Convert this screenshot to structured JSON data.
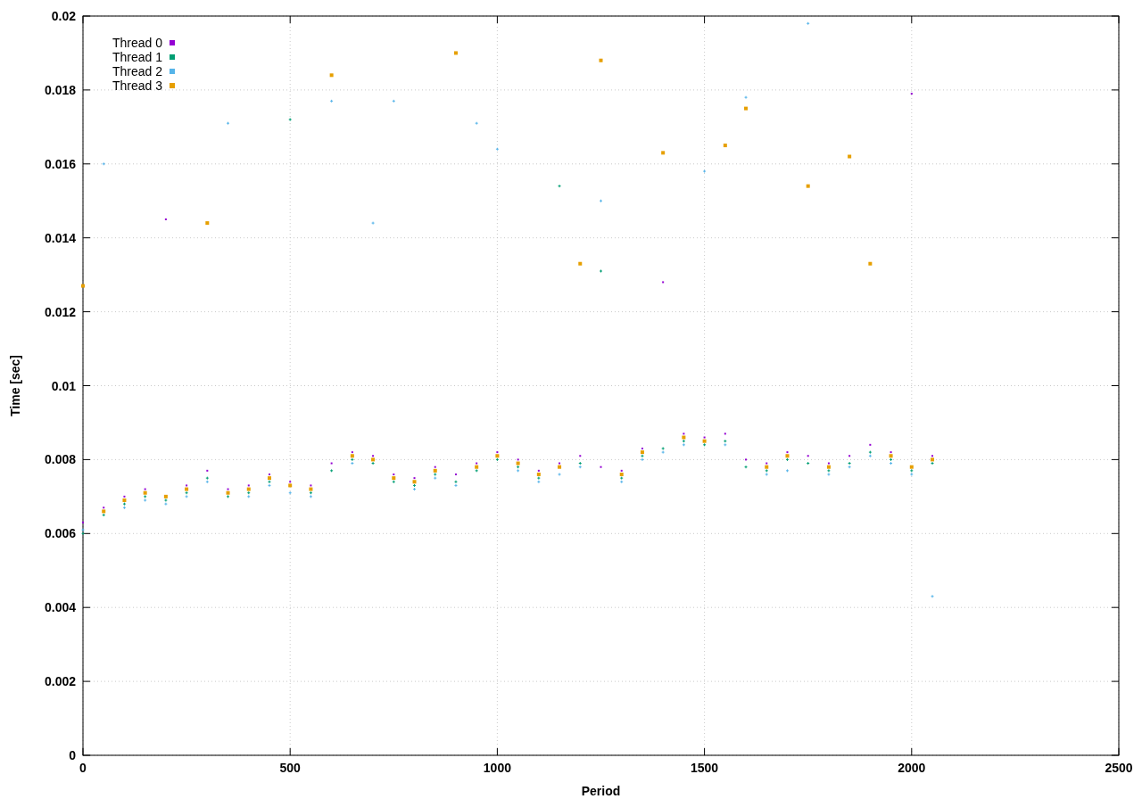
{
  "chart_data": {
    "type": "scatter",
    "grid": true,
    "xlabel": "Period",
    "ylabel": "Time [sec]",
    "xlim": [
      0,
      2500
    ],
    "ylim": [
      0,
      0.02
    ],
    "xticks": [
      0,
      500,
      1000,
      1500,
      2000,
      2500
    ],
    "yticks": [
      {
        "value": 0,
        "label": "0"
      },
      {
        "value": 0.002,
        "label": "0.002"
      },
      {
        "value": 0.004,
        "label": "0.004"
      },
      {
        "value": 0.006,
        "label": "0.006"
      },
      {
        "value": 0.008,
        "label": "0.008"
      },
      {
        "value": 0.01,
        "label": "0.01"
      },
      {
        "value": 0.012,
        "label": "0.012"
      },
      {
        "value": 0.014,
        "label": "0.014"
      },
      {
        "value": 0.016,
        "label": "0.016"
      },
      {
        "value": 0.018,
        "label": "0.018"
      },
      {
        "value": 0.02,
        "label": "0.02"
      }
    ],
    "x": [
      0,
      50,
      100,
      150,
      200,
      250,
      300,
      350,
      400,
      450,
      500,
      550,
      600,
      650,
      700,
      750,
      800,
      850,
      900,
      950,
      1000,
      1050,
      1100,
      1150,
      1200,
      1250,
      1300,
      1350,
      1400,
      1450,
      1500,
      1550,
      1600,
      1650,
      1700,
      1750,
      1800,
      1850,
      1900,
      1950,
      2000,
      2050
    ],
    "series": [
      {
        "name": "Thread 0",
        "color": "#9400d3",
        "values": [
          0.0063,
          0.0067,
          0.007,
          0.0072,
          0.0145,
          0.0073,
          0.0077,
          0.0072,
          0.0073,
          0.0076,
          0.0074,
          0.0073,
          0.0079,
          0.0082,
          0.0081,
          0.0076,
          0.0075,
          0.0078,
          0.0076,
          0.0079,
          0.0082,
          0.008,
          0.0077,
          0.0079,
          0.0081,
          0.0078,
          0.0077,
          0.0083,
          0.0128,
          0.0087,
          0.0086,
          0.0087,
          0.008,
          0.0079,
          0.0082,
          0.0081,
          0.0079,
          0.0081,
          0.0084,
          0.0082,
          0.0179,
          0.0081
        ]
      },
      {
        "name": "Thread 1",
        "color": "#009e73",
        "values": [
          0.006,
          0.0065,
          0.0068,
          0.007,
          0.0069,
          0.0071,
          0.0075,
          0.007,
          0.0071,
          0.0074,
          0.0172,
          0.0071,
          0.0077,
          0.008,
          0.0079,
          0.0074,
          0.0073,
          0.0076,
          0.0074,
          0.0077,
          0.008,
          0.0078,
          0.0075,
          0.0154,
          0.0079,
          0.0131,
          0.0075,
          0.0081,
          0.0083,
          0.0085,
          0.0084,
          0.0085,
          0.0078,
          0.0077,
          0.008,
          0.0079,
          0.0077,
          0.0079,
          0.0082,
          0.008,
          0.0077,
          0.0079
        ]
      },
      {
        "name": "Thread 2",
        "color": "#56b4e9",
        "values": [
          0.0061,
          0.016,
          0.0067,
          0.0069,
          0.0068,
          0.007,
          0.0074,
          0.0171,
          0.007,
          0.0073,
          0.0071,
          0.007,
          0.0177,
          0.0079,
          0.0144,
          0.0177,
          0.0072,
          0.0075,
          0.0073,
          0.0171,
          0.0164,
          0.0077,
          0.0074,
          0.0076,
          0.0078,
          0.015,
          0.0074,
          0.008,
          0.0082,
          0.0084,
          0.0158,
          0.0084,
          0.0178,
          0.0076,
          0.0077,
          0.0198,
          0.0076,
          0.0078,
          0.0081,
          0.0079,
          0.0076,
          0.0043
        ]
      },
      {
        "name": "Thread 3",
        "color": "#e69f00",
        "values": [
          0.0127,
          0.0066,
          0.0069,
          0.0071,
          0.007,
          0.0072,
          0.0144,
          0.0071,
          0.0072,
          0.0075,
          0.0073,
          0.0072,
          0.0184,
          0.0081,
          0.008,
          0.0075,
          0.0074,
          0.0077,
          0.019,
          0.0078,
          0.0081,
          0.0079,
          0.0076,
          0.0078,
          0.0133,
          0.0188,
          0.0076,
          0.0082,
          0.0163,
          0.0086,
          0.0085,
          0.0165,
          0.0175,
          0.0078,
          0.0081,
          0.0154,
          0.0078,
          0.0162,
          0.0133,
          0.0081,
          0.0078,
          0.008
        ]
      }
    ]
  }
}
